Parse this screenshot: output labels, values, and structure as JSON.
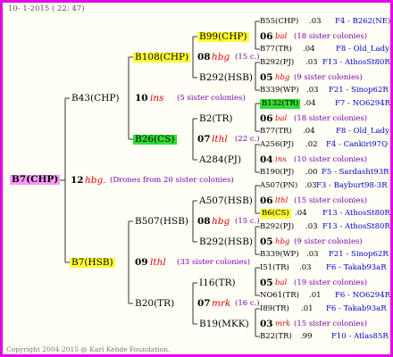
{
  "header": "10-  1-2015 ( 22: 47)",
  "footer": "Copyright 2004-2015 @ Karl Kehde Foundation.",
  "root": {
    "name": "B7(CHP)",
    "num": "12",
    "code": "hbg.",
    "note": "(Drones from 20 sister colonies)"
  },
  "gen1": [
    {
      "name": "B43(CHP)",
      "num": "10",
      "code": "ins",
      "note": "(5 sister colonies)"
    },
    {
      "name": "B7(HSB)",
      "num": "09",
      "code": "lthl",
      "note": "(33 sister colonies)"
    }
  ],
  "gen2": [
    {
      "name": "B108(CHP)",
      "num": "08",
      "code": "hbg",
      "note": "(15 c.)"
    },
    {
      "name": "B26(CS)",
      "num": "07",
      "code": "lthl",
      "note": "(22 c.)"
    },
    {
      "name": "B507(HSB)",
      "num": "08",
      "code": "hbg",
      "note": "(15 c.)"
    },
    {
      "name": "B20(TR)",
      "num": "07",
      "code": "mrk",
      "note": "(16 c.)"
    }
  ],
  "gen3": [
    {
      "name": "B99(CHP)",
      "num": "06",
      "code": "bal",
      "note": "(18 sister colonies)"
    },
    {
      "name": "B292(HSB)",
      "num": "05",
      "code": "hbg",
      "note": "(9 sister colonies)"
    },
    {
      "name": "B2(TR)",
      "num": "06",
      "code": "bal",
      "note": "(18 sister colonies)"
    },
    {
      "name": "A284(PJ)",
      "num": "04",
      "code": "ins",
      "note": "(10 sister colonies)"
    },
    {
      "name": "A507(HSB)",
      "num": "06",
      "code": "lthl",
      "note": "(15 sister colonies)"
    },
    {
      "name": "B292(HSB)",
      "num": "05",
      "code": "hbg",
      "note": "(9 sister colonies)"
    },
    {
      "name": "I16(TR)",
      "num": "05",
      "code": "bal",
      "note": "(19 sister colonies)"
    },
    {
      "name": "B19(MKK)",
      "num": "03",
      "code": "mrk",
      "note": "(15 sister colonies)"
    }
  ],
  "gen4": [
    {
      "name": "B55(CHP)",
      "num": ".03",
      "ref": "F4 - B262(NE)"
    },
    {
      "name": "B77(TR)",
      "num": ".04",
      "ref": "F8 - Old_Lady"
    },
    {
      "name": "B292(PJ)",
      "num": ".03",
      "ref": "F13 - AthosSt80R"
    },
    {
      "name": "B339(WP)",
      "num": ".03",
      "ref": "F21 - Sinop62R"
    },
    {
      "name": "B132(TR)",
      "num": ".04",
      "ref": "F7 - NO6294R"
    },
    {
      "name": "B77(TR)",
      "num": ".04",
      "ref": "F8 - Old_Lady"
    },
    {
      "name": "A256(PJ)",
      "num": ".02",
      "ref": "F4 - Cankiri97Q"
    },
    {
      "name": "B190(PJ)",
      "num": ".00",
      "ref": "F5 - Sardasht93R"
    },
    {
      "name": "A507(PN)",
      "num": ".03",
      "ref": "F3 - Bayburt98-3R"
    },
    {
      "name": "B6(CS)",
      "num": ".04",
      "ref": "F13 - AthosSt80R"
    },
    {
      "name": "B292(PJ)",
      "num": ".03",
      "ref": "F13 - AthosSt80R"
    },
    {
      "name": "B339(WP)",
      "num": ".03",
      "ref": "F21 - Sinop62R"
    },
    {
      "name": "I51(TR)",
      "num": ".03",
      "ref": "F6 - Takab93aR"
    },
    {
      "name": "NO61(TR)",
      "num": ".01",
      "ref": "F6 - NO6294R"
    },
    {
      "name": "I89(TR)",
      "num": ".01",
      "ref": "F6 - Takab93aR"
    },
    {
      "name": "B22(TR)",
      "num": ".99",
      "ref": "F10 - Atlas85R"
    }
  ]
}
